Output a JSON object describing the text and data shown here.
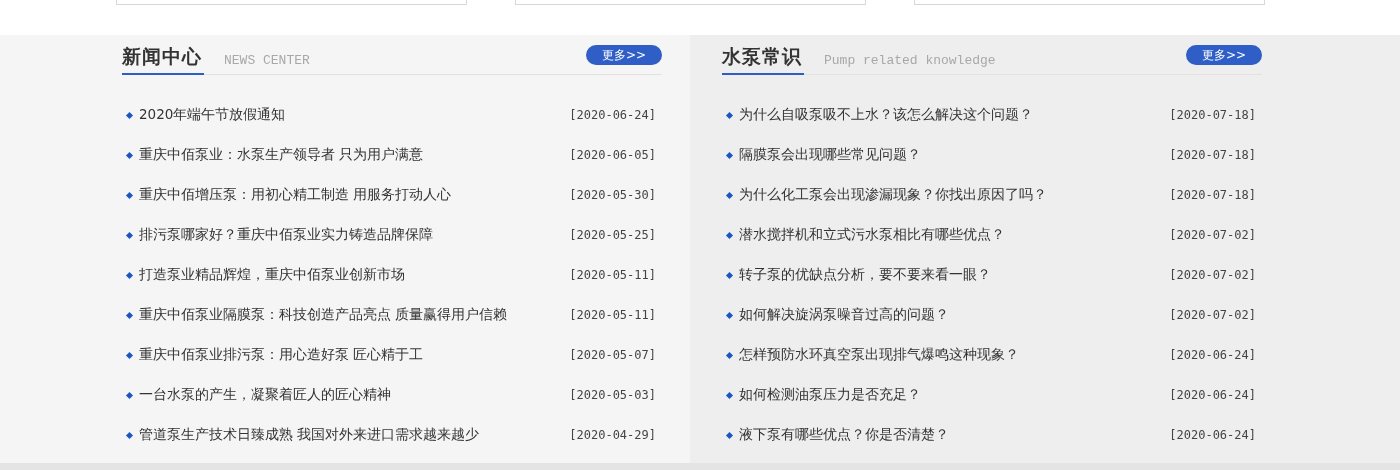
{
  "top_cards": [
    {
      "kind": "outline"
    },
    {
      "kind": "outline"
    },
    {
      "kind": "outline"
    }
  ],
  "sections": [
    {
      "title": "新闻中心",
      "subtitle": "NEWS CENTER",
      "more": "更多>>",
      "items": [
        {
          "title": "2020年端午节放假通知",
          "date": "[2020-06-24]"
        },
        {
          "title": "重庆中佰泵业：水泵生产领导者 只为用户满意",
          "date": "[2020-06-05]"
        },
        {
          "title": "重庆中佰增压泵：用初心精工制造 用服务打动人心",
          "date": "[2020-05-30]"
        },
        {
          "title": "排污泵哪家好？重庆中佰泵业实力铸造品牌保障",
          "date": "[2020-05-25]"
        },
        {
          "title": "打造泵业精品辉煌，重庆中佰泵业创新市场",
          "date": "[2020-05-11]"
        },
        {
          "title": "重庆中佰泵业隔膜泵：科技创造产品亮点 质量赢得用户信赖",
          "date": "[2020-05-11]"
        },
        {
          "title": "重庆中佰泵业排污泵：用心造好泵 匠心精于工",
          "date": "[2020-05-07]"
        },
        {
          "title": "一台水泵的产生，凝聚着匠人的匠心精神",
          "date": "[2020-05-03]"
        },
        {
          "title": "管道泵生产技术日臻成熟 我国对外来进口需求越来越少",
          "date": "[2020-04-29]"
        }
      ]
    },
    {
      "title": "水泵常识",
      "subtitle": "Pump related knowledge",
      "more": "更多>>",
      "items": [
        {
          "title": "为什么自吸泵吸不上水？该怎么解决这个问题？",
          "date": "[2020-07-18]"
        },
        {
          "title": "隔膜泵会出现哪些常见问题？",
          "date": "[2020-07-18]"
        },
        {
          "title": "为什么化工泵会出现渗漏现象？你找出原因了吗？",
          "date": "[2020-07-18]"
        },
        {
          "title": "潜水搅拌机和立式污水泵相比有哪些优点？",
          "date": "[2020-07-02]"
        },
        {
          "title": "转子泵的优缺点分析，要不要来看一眼？",
          "date": "[2020-07-02]"
        },
        {
          "title": "如何解决旋涡泵噪音过高的问题？",
          "date": "[2020-07-02]"
        },
        {
          "title": "怎样预防水环真空泵出现排气爆鸣这种现象？",
          "date": "[2020-06-24]"
        },
        {
          "title": "如何检测油泵压力是否充足？",
          "date": "[2020-06-24]"
        },
        {
          "title": "液下泵有哪些优点？你是否清楚？",
          "date": "[2020-06-24]"
        }
      ]
    }
  ]
}
